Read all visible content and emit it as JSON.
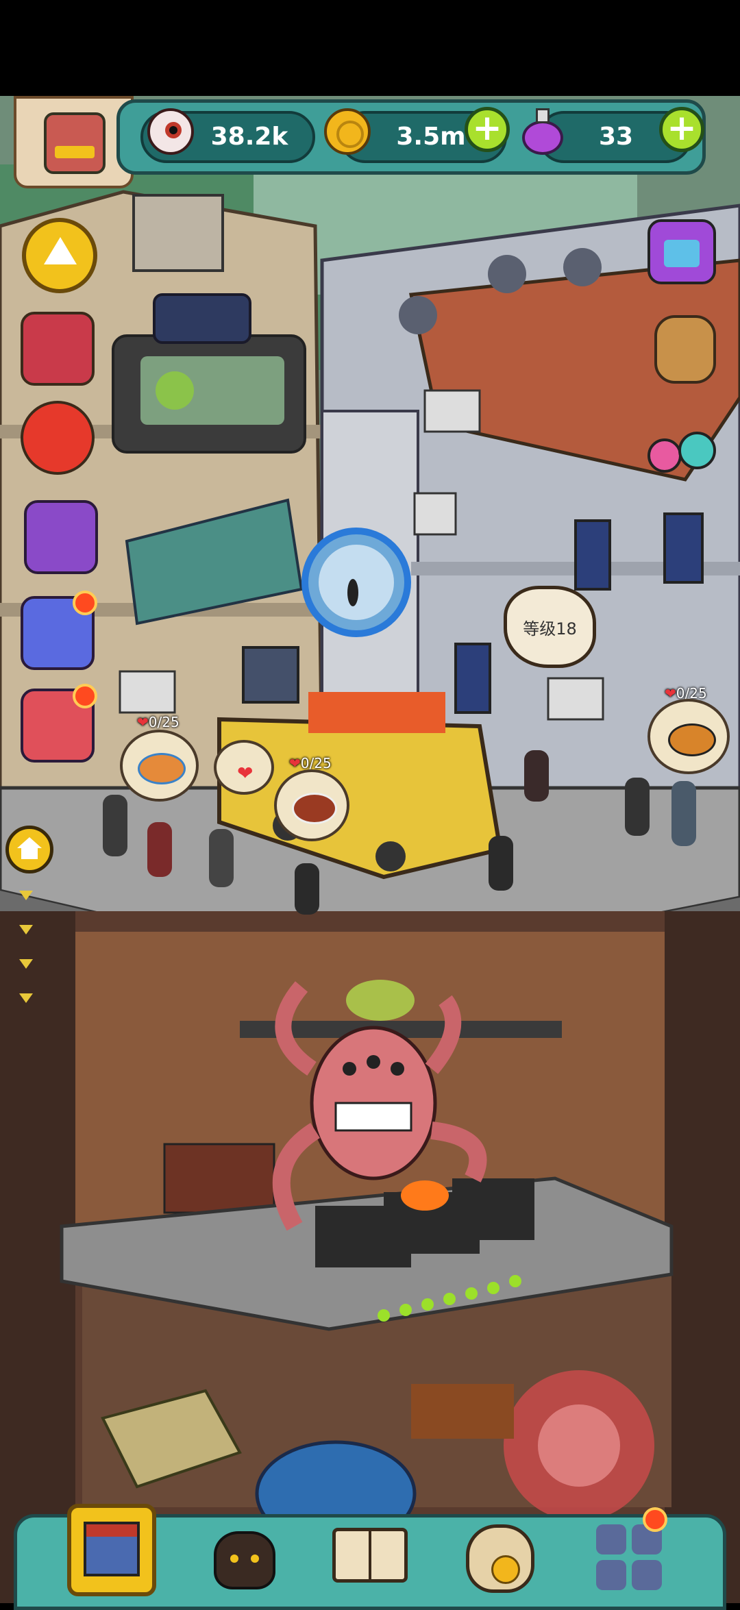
{
  "hud": {
    "eyes_value": "38.2k",
    "coins_value": "3.5m",
    "potion_value": "33",
    "plus_label": "+"
  },
  "scene": {
    "level_label": "等级18",
    "hearts": [
      {
        "label": "0/25"
      },
      {
        "label": "0/25"
      },
      {
        "label": "0/25"
      }
    ]
  },
  "colors": {
    "hud_bg": "#3f9e98",
    "pill_bg": "#1f6a68",
    "plus_green": "#a9e02d",
    "notify_dot": "#ff4a1f"
  },
  "icons": {
    "eyes": "eyeball-icon",
    "coins": "gold-coin-icon",
    "potion": "purple-potion-icon"
  }
}
